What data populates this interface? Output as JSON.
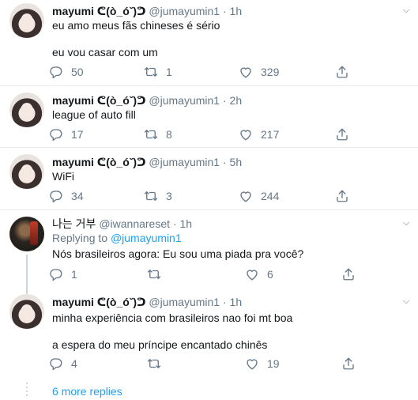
{
  "tweets": [
    {
      "name": "mayumi ᕦ(ò_óˇ)ᕤ",
      "handle": "@jumayumin1",
      "sep": "·",
      "time": "1h",
      "lines": [
        "eu amo meus fãs chineses é sério",
        "eu vou casar com um"
      ],
      "replies": "50",
      "retweets": "1",
      "likes": "329"
    },
    {
      "name": "mayumi ᕦ(ò_óˇ)ᕤ",
      "handle": "@jumayumin1",
      "sep": "·",
      "time": "2h",
      "lines": [
        "league of auto fill"
      ],
      "replies": "17",
      "retweets": "8",
      "likes": "217"
    },
    {
      "name": "mayumi ᕦ(ò_óˇ)ᕤ",
      "handle": "@jumayumin1",
      "sep": "·",
      "time": "5h",
      "lines": [
        "WiFi"
      ],
      "replies": "34",
      "retweets": "3",
      "likes": "244"
    },
    {
      "name": "나는 거부",
      "handle": "@iwannareset",
      "sep": "·",
      "time": "1h",
      "replying_prefix": "Replying to ",
      "replying_handle": "@jumayumin1",
      "lines": [
        "Nós brasileiros agora: Eu sou uma piada pra você?"
      ],
      "replies": "1",
      "retweets": "",
      "likes": "6"
    },
    {
      "name": "mayumi ᕦ(ò_óˇ)ᕤ",
      "handle": "@jumayumin1",
      "sep": "·",
      "time": "1h",
      "lines": [
        "minha experiência com brasileiros nao foi mt boa",
        "a espera do meu príncipe encantado chinês"
      ],
      "replies": "4",
      "retweets": "",
      "likes": "19"
    }
  ],
  "more_replies": "6 more replies",
  "icons": {
    "reply": "reply-icon",
    "retweet": "retweet-icon",
    "like": "heart-icon",
    "share": "share-icon",
    "menu": "chevron-down-icon"
  },
  "colors": {
    "accent": "#1da1f2",
    "secondary_text": "#657786",
    "separator": "#e6ecf0"
  }
}
